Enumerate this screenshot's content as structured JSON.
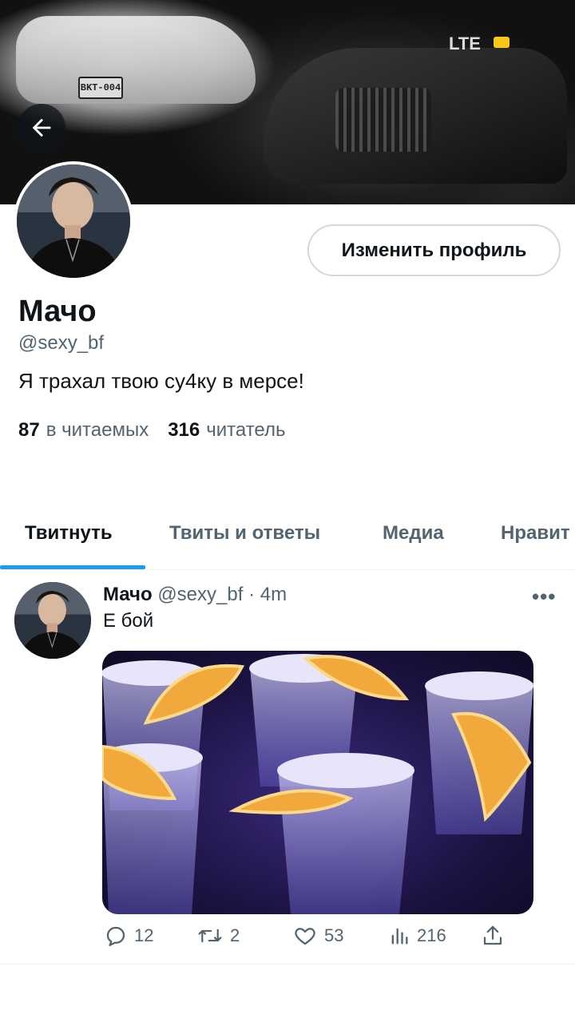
{
  "banner": {
    "plate_text": "BKT-004",
    "status": {
      "network": "LTE",
      "battery_color": "#f7c815"
    }
  },
  "profile": {
    "display_name": "Мачо",
    "handle": "@sexy_bf",
    "bio": "Я трахал твою су4ку в мерсе!",
    "edit_button_label": "Изменить профиль",
    "following_count": "87",
    "following_label": "в читаемых",
    "followers_count": "316",
    "followers_label": "читатель"
  },
  "tabs": [
    {
      "label": "Твитнуть",
      "active": true
    },
    {
      "label": "Твиты и ответы",
      "active": false
    },
    {
      "label": "Медиа",
      "active": false
    },
    {
      "label": "Нравит",
      "active": false
    }
  ],
  "tweet": {
    "author_name": "Мачо",
    "author_handle": "@sexy_bf",
    "separator": "·",
    "time": "4m",
    "more_label": "•••",
    "text": "Е бой",
    "replies": "12",
    "retweets": "2",
    "likes": "53",
    "views": "216"
  },
  "colors": {
    "accent": "#1d9bf0",
    "text_primary": "#0f1419",
    "text_secondary": "#536471",
    "border": "#cfd9de"
  },
  "icons": {
    "back": "arrow-left-icon",
    "reply": "speech-bubble-icon",
    "retweet": "retweet-icon",
    "like": "heart-icon",
    "views": "bar-chart-icon",
    "share": "share-icon",
    "more": "more-dots-icon"
  }
}
